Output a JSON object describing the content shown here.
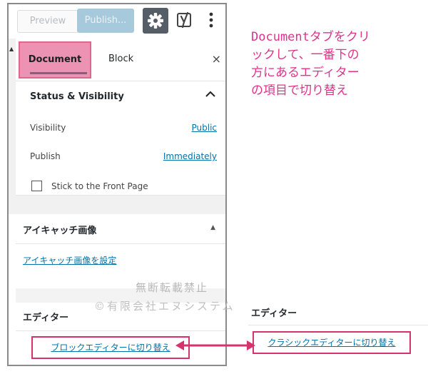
{
  "toolbar": {
    "preview_label": "Preview",
    "publish_label": "Publish...",
    "settings_icon": "gear-icon",
    "yoast_icon": "yoast-icon",
    "more_icon": "more-vertical-icon"
  },
  "tabs": {
    "document": "Document",
    "block": "Block",
    "close": "×"
  },
  "status": {
    "title": "Status & Visibility",
    "visibility_label": "Visibility",
    "visibility_value": "Public",
    "publish_label": "Publish",
    "publish_value": "Immediately",
    "stick_label": "Stick to the Front Page"
  },
  "featured_image": {
    "title": "アイキャッチ画像",
    "set_link": "アイキャッチ画像を設定"
  },
  "editor": {
    "title": "エディター",
    "switch_classic_label": "ブロックエディターに切り替え"
  },
  "editor_right": {
    "title": "エディター",
    "switch_classic_label": "クラシックエディターに切り替え"
  },
  "annotation": {
    "line1": "Documentタブをクリ",
    "line2": "ックして、一番下の",
    "line3": "方にあるエディター",
    "line4": "の項目で切り替え"
  },
  "watermark": {
    "line1": "無断転載禁止",
    "line2": "©有限会社エヌシステム"
  },
  "colors": {
    "highlight": "#d6336c",
    "annotation": "#e0338a",
    "link": "#0073aa",
    "tab_highlight": "#ec93b3"
  }
}
